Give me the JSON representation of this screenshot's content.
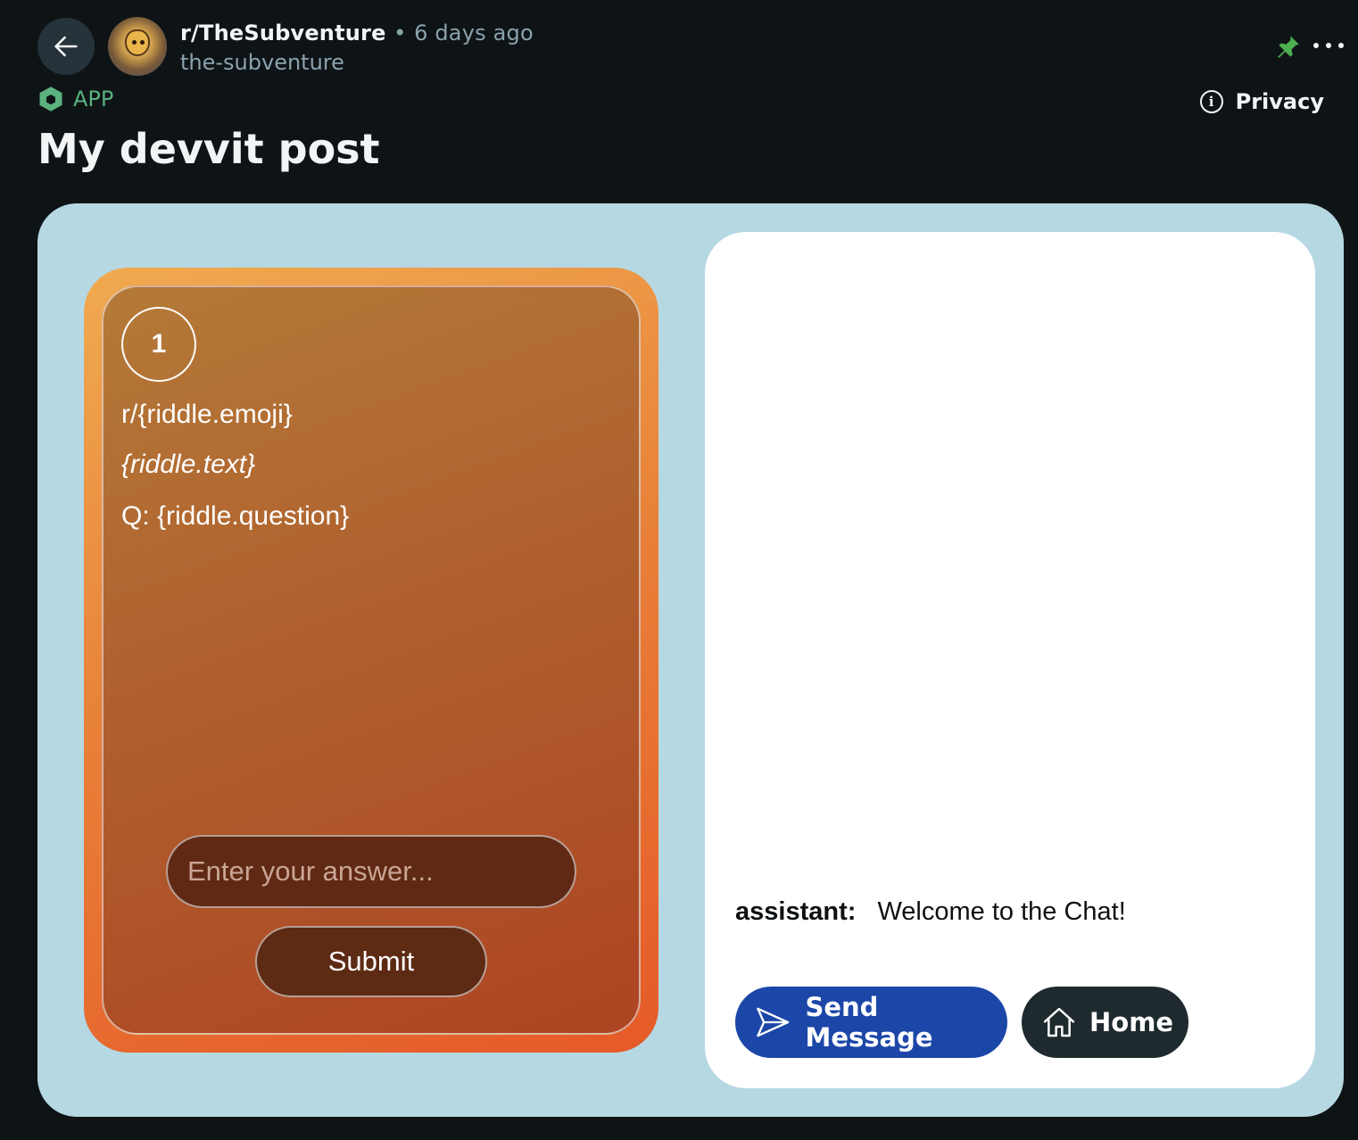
{
  "header": {
    "subreddit": "r/TheSubventure",
    "separator": "•",
    "time_ago": "6 days ago",
    "username": "the-subventure",
    "app_label": "APP",
    "privacy_label": "Privacy",
    "post_title": "My devvit post"
  },
  "riddle": {
    "number": "1",
    "emoji_line": "r/{riddle.emoji}",
    "text_line": "{riddle.text}",
    "question_line": "Q: {riddle.question}",
    "answer_placeholder": "Enter your answer...",
    "submit_label": "Submit"
  },
  "chat": {
    "role": "assistant:",
    "message": "Welcome to the Chat!",
    "send_label": "Send Message",
    "home_label": "Home"
  },
  "colors": {
    "background": "#0e1416",
    "app_tag": "#5bb27e",
    "frame": "#b6d8e3",
    "send_button": "#1c47a8",
    "home_button": "#1f2a2e",
    "riddle_card": "#e8823a"
  }
}
